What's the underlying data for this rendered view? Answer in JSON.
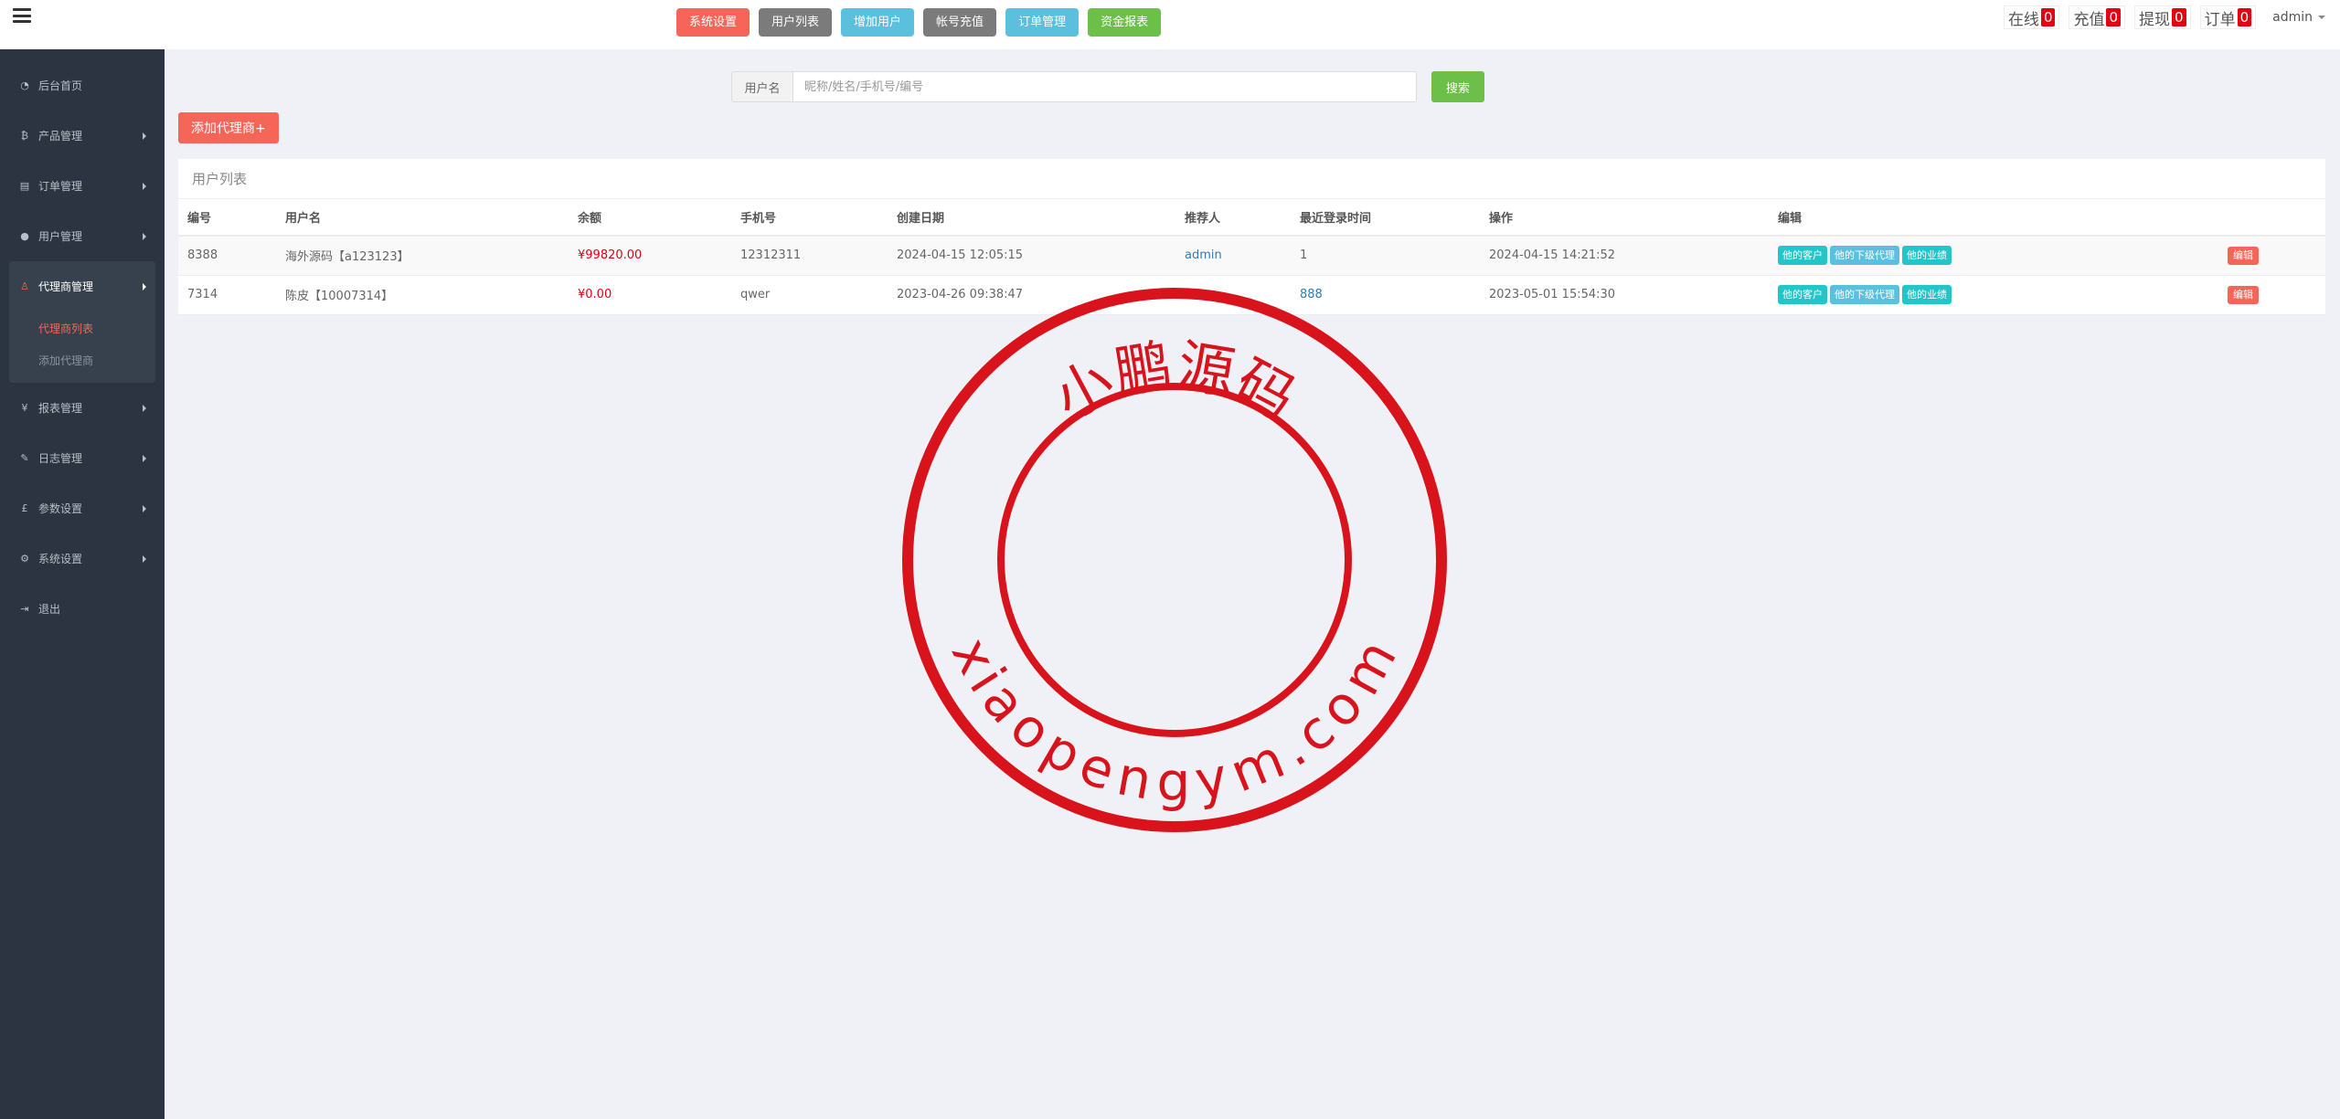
{
  "topbar": {
    "quick_buttons": [
      {
        "label": "系统设置",
        "color": "#f56659"
      },
      {
        "label": "用户列表",
        "color": "#7b7b7b"
      },
      {
        "label": "增加用户",
        "color": "#5bc0de"
      },
      {
        "label": "帐号充值",
        "color": "#7b7b7b"
      },
      {
        "label": "订单管理",
        "color": "#5bc0de"
      },
      {
        "label": "资金报表",
        "color": "#6cc04a"
      }
    ],
    "stats": [
      {
        "label": "在线",
        "count": "0"
      },
      {
        "label": "充值",
        "count": "0"
      },
      {
        "label": "提现",
        "count": "0"
      },
      {
        "label": "订单",
        "count": "0"
      }
    ],
    "user": "admin"
  },
  "sidebar": {
    "items": [
      {
        "label": "后台首页",
        "icon": "dashboard-icon",
        "glyph": "◔"
      },
      {
        "label": "产品管理",
        "icon": "bitcoin-icon",
        "glyph": "₿"
      },
      {
        "label": "订单管理",
        "icon": "copy-icon",
        "glyph": "▤"
      },
      {
        "label": "用户管理",
        "icon": "user-icon",
        "glyph": "●"
      },
      {
        "label": "代理商管理",
        "icon": "sitemap-icon",
        "glyph": "♙"
      },
      {
        "label": "报表管理",
        "icon": "yen-icon",
        "glyph": "¥"
      },
      {
        "label": "日志管理",
        "icon": "ticket-icon",
        "glyph": "✎"
      },
      {
        "label": "参数设置",
        "icon": "pound-icon",
        "glyph": "£"
      },
      {
        "label": "系统设置",
        "icon": "gears-icon",
        "glyph": "⚙"
      },
      {
        "label": "退出",
        "icon": "sign-out-icon",
        "glyph": "⇥"
      }
    ],
    "sub_items": [
      "代理商列表",
      "添加代理商"
    ]
  },
  "search": {
    "label": "用户名",
    "placeholder": "昵称/姓名/手机号/编号",
    "button": "搜索"
  },
  "add_button": "添加代理商+",
  "panel_title": "用户列表",
  "table": {
    "headers": [
      "编号",
      "用户名",
      "余额",
      "手机号",
      "创建日期",
      "推荐人",
      "最近登录时间",
      "操作",
      "编辑",
      ""
    ],
    "rows": [
      {
        "id": "8388",
        "username": "海外源码【a123123】",
        "balance": "¥99820.00",
        "phone": "12312311",
        "created": "2024-04-15 12:05:15",
        "referrer": "admin",
        "last_login": "1",
        "operation": "2024-04-15 14:21:52"
      },
      {
        "id": "7314",
        "username": "陈皮【10007314】",
        "balance": "¥0.00",
        "phone": "qwer",
        "created": "2023-04-26 09:38:47",
        "referrer": "",
        "last_login": "888",
        "operation": "2023-05-01 15:54:30"
      }
    ],
    "tags": [
      "他的客户",
      "他的下级代理",
      "他的业绩"
    ],
    "edit_label": "编辑"
  },
  "watermark": {
    "top_text": "小鹏源码",
    "bottom_text": "xiaopengym.com",
    "color": "#d8131b"
  }
}
